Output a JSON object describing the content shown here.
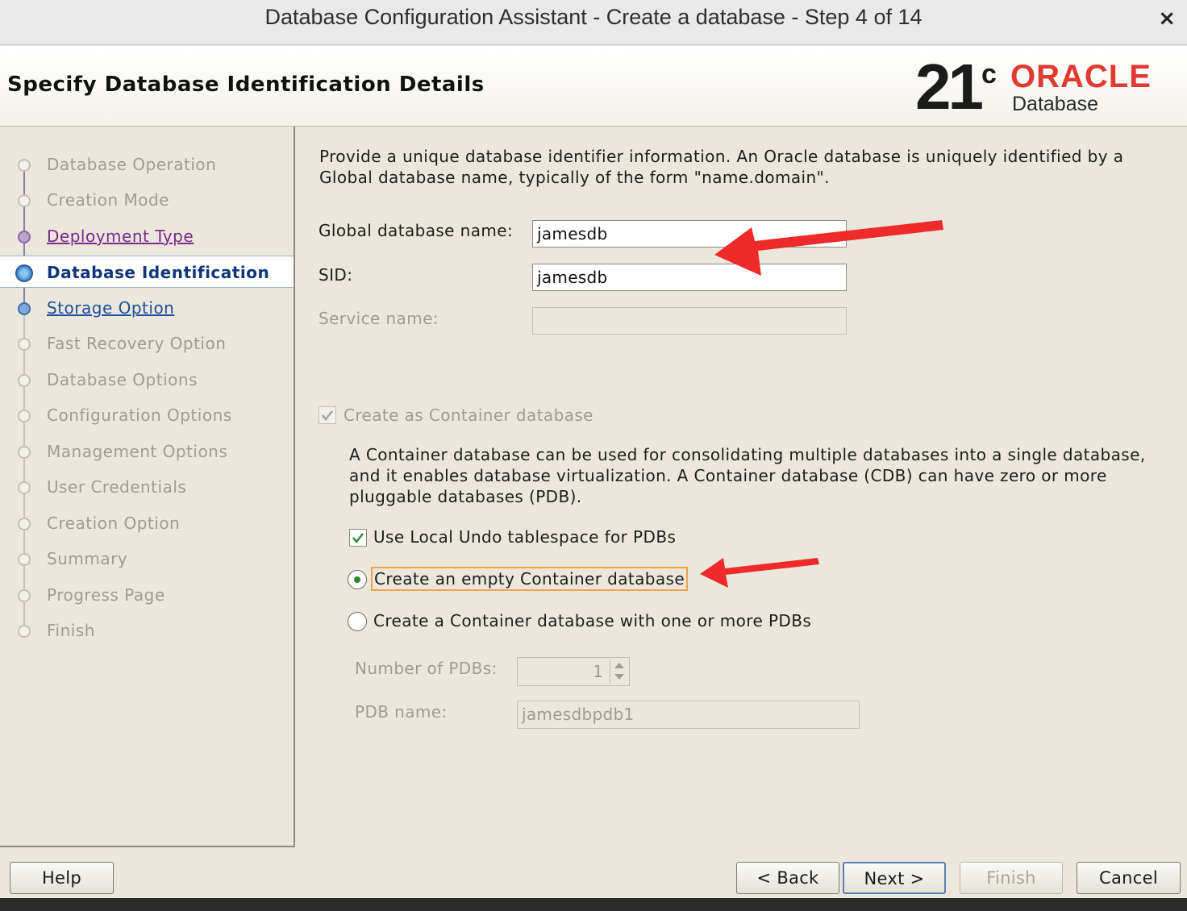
{
  "window": {
    "title": "Database Configuration Assistant - Create a database - Step 4 of 14",
    "close_glyph": "×"
  },
  "header": {
    "page_title": "Specify Database Identification Details",
    "logo": {
      "version": "21",
      "version_sup": "c",
      "brand": "ORACLE",
      "product": "Database",
      "brand_color": "#e03b31"
    }
  },
  "steps": [
    {
      "label": "Database Operation",
      "state": "disabled"
    },
    {
      "label": "Creation Mode",
      "state": "disabled"
    },
    {
      "label": "Deployment Type",
      "state": "visited"
    },
    {
      "label": "Database Identification",
      "state": "current"
    },
    {
      "label": "Storage Option",
      "state": "next"
    },
    {
      "label": "Fast Recovery Option",
      "state": "disabled"
    },
    {
      "label": "Database Options",
      "state": "disabled"
    },
    {
      "label": "Configuration Options",
      "state": "disabled"
    },
    {
      "label": "Management Options",
      "state": "disabled"
    },
    {
      "label": "User Credentials",
      "state": "disabled"
    },
    {
      "label": "Creation Option",
      "state": "disabled"
    },
    {
      "label": "Summary",
      "state": "disabled"
    },
    {
      "label": "Progress Page",
      "state": "disabled"
    },
    {
      "label": "Finish",
      "state": "disabled"
    }
  ],
  "main": {
    "intro_line1": "Provide a unique database identifier information. An Oracle database is uniquely identified by a",
    "intro_line2": "Global database name, typically of the form \"name.domain\".",
    "global_db_name": {
      "label": "Global database name:",
      "value": "jamesdb"
    },
    "sid": {
      "label": "SID:",
      "value": "jamesdb"
    },
    "service_name": {
      "label": "Service name:",
      "value": ""
    },
    "container_db": {
      "label": "Create as Container database",
      "checked": true,
      "enabled": false
    },
    "cdb_desc_line1": "A Container database can be used for consolidating multiple databases into a single database,",
    "cdb_desc_line2": "and it enables database virtualization. A Container database (CDB) can have zero or more",
    "cdb_desc_line3": "pluggable databases (PDB).",
    "local_undo": {
      "label": "Use Local Undo tablespace for PDBs",
      "checked": true
    },
    "empty_cdb": {
      "label": "Create an empty Container database",
      "selected": true
    },
    "cdb_with_pdbs": {
      "label": "Create a Container database with one or more PDBs",
      "selected": false
    },
    "num_pdbs": {
      "label": "Number of PDBs:",
      "value": "1"
    },
    "pdb_name": {
      "label": "PDB name:",
      "value": "jamesdbpdb1"
    }
  },
  "buttons": {
    "help": "Help",
    "back": "< Back",
    "next": "Next >",
    "finish": "Finish",
    "cancel": "Cancel"
  },
  "colors": {
    "annotation_arrow": "#ee2a2a",
    "focus_border": "#f0a348",
    "checkmark": "#2d8b2d"
  }
}
